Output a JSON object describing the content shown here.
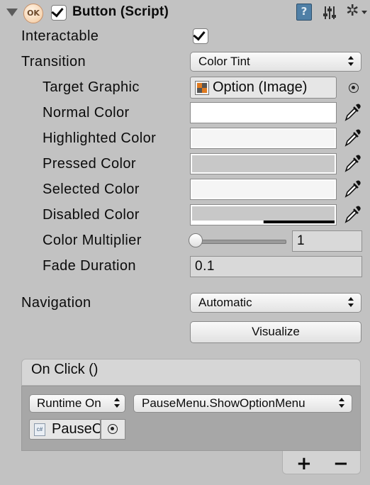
{
  "component": {
    "title": "Button (Script)",
    "ok_badge": "OK",
    "enabled": true,
    "help_glyph": "?",
    "presets_icon": "sliders-icon",
    "gear_glyph": "✲"
  },
  "properties": {
    "interactable_label": "Interactable",
    "interactable_checked": true,
    "transition_label": "Transition",
    "transition_value": "Color Tint",
    "target_graphic_label": "Target Graphic",
    "target_graphic_value": "Option (Image)",
    "normal_color_label": "Normal Color",
    "normal_color": "#ffffff",
    "highlighted_color_label": "Highlighted Color",
    "highlighted_color": "#f5f5f5",
    "pressed_color_label": "Pressed Color",
    "pressed_color": "#c8c8c8",
    "selected_color_label": "Selected Color",
    "selected_color": "#f5f5f5",
    "disabled_color_label": "Disabled Color",
    "disabled_color": "#c8c8c8",
    "disabled_alpha": 0.5,
    "color_multiplier_label": "Color Multiplier",
    "color_multiplier_value": "1",
    "color_multiplier_fraction": 0,
    "fade_duration_label": "Fade Duration",
    "fade_duration_value": "0.1"
  },
  "navigation": {
    "label": "Navigation",
    "value": "Automatic",
    "visualize_label": "Visualize"
  },
  "on_click": {
    "title": "On Click ()",
    "runtime_value": "Runtime On",
    "function_value": "PauseMenu.ShowOptionMenu",
    "object_value": "PauseC",
    "script_icon_text": "c#",
    "add_label": "+",
    "remove_label": "−"
  }
}
